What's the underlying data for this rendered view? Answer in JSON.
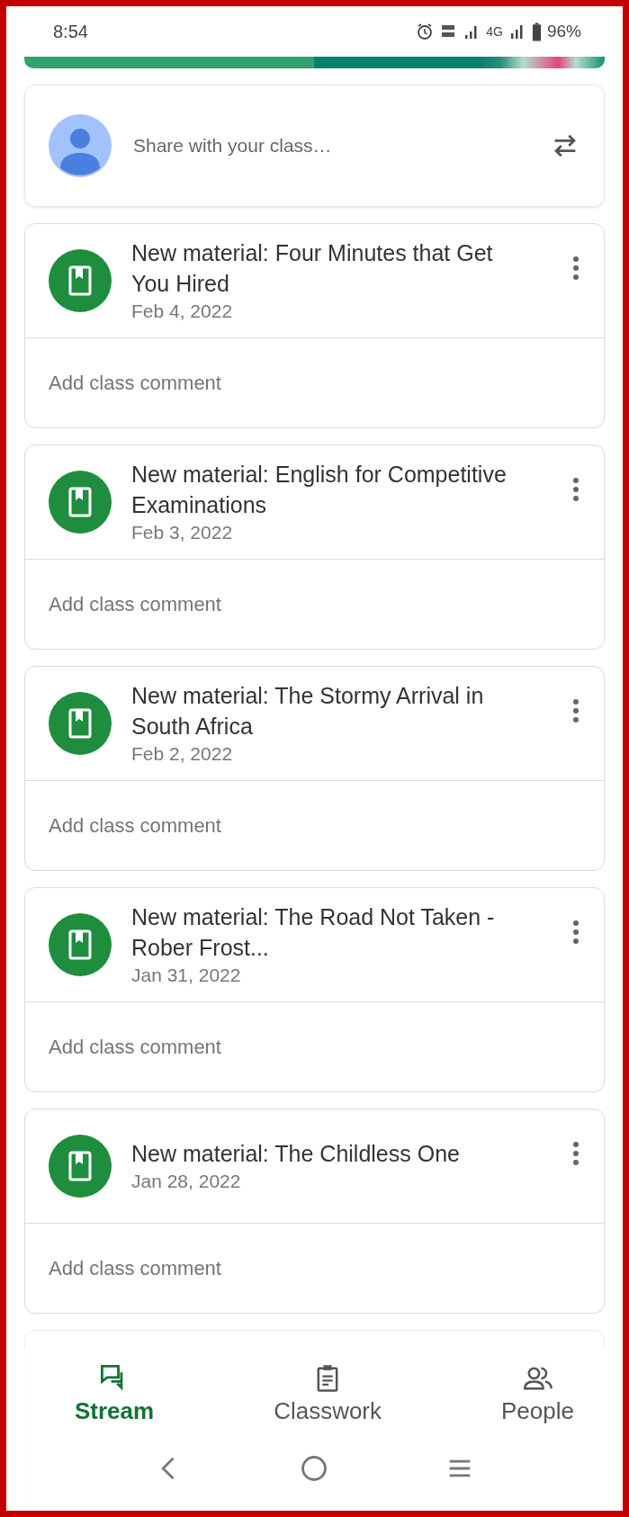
{
  "status_bar": {
    "time": "8:54",
    "network": "4G",
    "battery": "96%"
  },
  "composer": {
    "placeholder": "Share with your class…"
  },
  "posts": [
    {
      "title": "New material: Four Minutes that Get You Hired",
      "date": "Feb 4, 2022",
      "comment_placeholder": "Add class comment"
    },
    {
      "title": "New material: English for Competitive Examinations",
      "date": "Feb 3, 2022",
      "comment_placeholder": "Add class comment"
    },
    {
      "title": "New material: The Stormy Arrival in South Africa",
      "date": "Feb 2, 2022",
      "comment_placeholder": "Add class comment"
    },
    {
      "title": "New material: The Road Not Taken -Rober Frost...",
      "date": "Jan 31, 2022",
      "comment_placeholder": "Add class comment"
    },
    {
      "title": "New material: The Childless One",
      "date": "Jan 28, 2022",
      "comment_placeholder": "Add class comment"
    }
  ],
  "bottom_nav": [
    {
      "kind": "stream",
      "label": "Stream",
      "selected": true
    },
    {
      "kind": "classwork",
      "label": "Classwork",
      "selected": false
    },
    {
      "kind": "people",
      "label": "People",
      "selected": false
    }
  ]
}
